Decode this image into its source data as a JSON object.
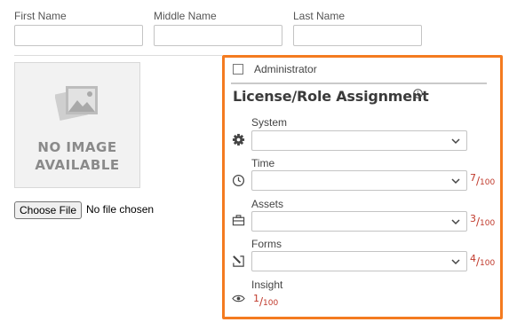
{
  "name_fields": {
    "first_label": "First Name",
    "middle_label": "Middle Name",
    "last_label": "Last Name",
    "first_value": "",
    "middle_value": "",
    "last_value": ""
  },
  "photo": {
    "line1": "NO IMAGE",
    "line2": "AVAILABLE"
  },
  "file_upload": {
    "button_label": "Choose File",
    "status": "No file chosen"
  },
  "panel": {
    "admin_label": "Administrator",
    "admin_checked": false,
    "title": "License/Role Assignment",
    "accent_color": "#f47b20",
    "licenses": [
      {
        "label": "System",
        "icon": "gear-icon",
        "used": "",
        "total": ""
      },
      {
        "label": "Time",
        "icon": "clock-icon",
        "used": "7",
        "total": "100"
      },
      {
        "label": "Assets",
        "icon": "briefcase-icon",
        "used": "3",
        "total": "100"
      },
      {
        "label": "Forms",
        "icon": "form-edit-icon",
        "used": "4",
        "total": "100"
      },
      {
        "label": "Insight",
        "icon": "eye-icon",
        "used": "1",
        "total": "100"
      }
    ]
  }
}
